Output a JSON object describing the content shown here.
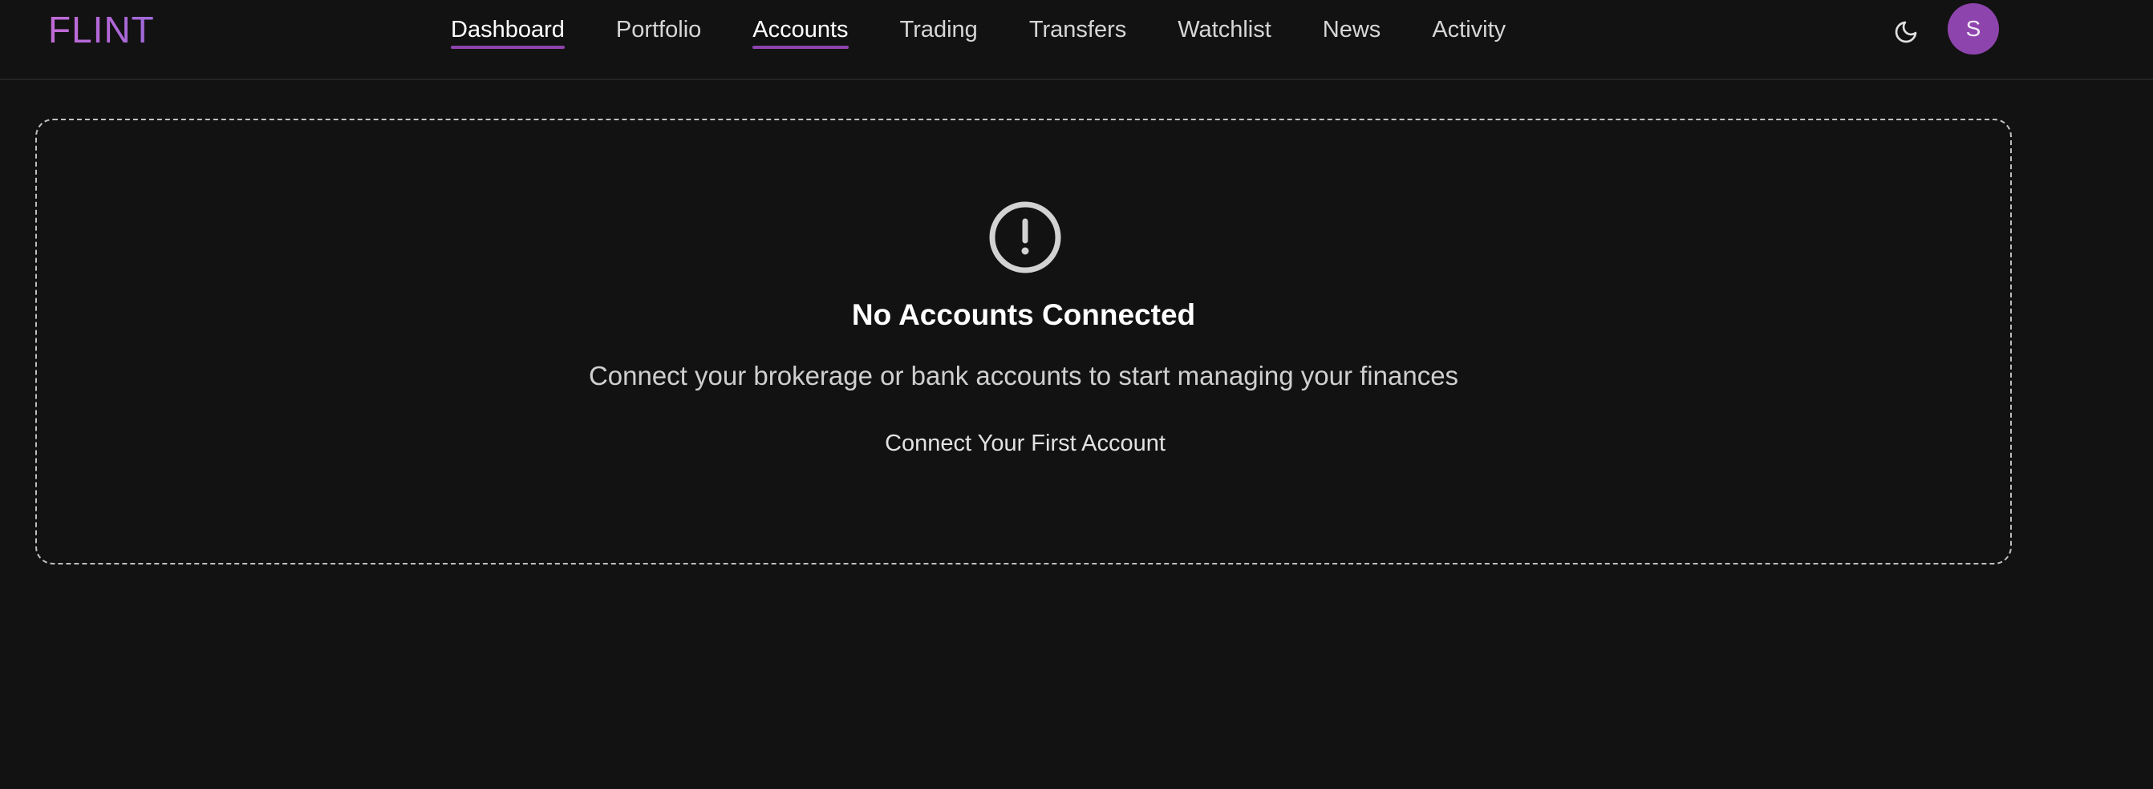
{
  "app": {
    "logo": "FLINT"
  },
  "nav": {
    "items": [
      {
        "label": "Dashboard",
        "active": true
      },
      {
        "label": "Portfolio",
        "active": false
      },
      {
        "label": "Accounts",
        "active": true
      },
      {
        "label": "Trading",
        "active": false
      },
      {
        "label": "Transfers",
        "active": false
      },
      {
        "label": "Watchlist",
        "active": false
      },
      {
        "label": "News",
        "active": false
      },
      {
        "label": "Activity",
        "active": false
      }
    ]
  },
  "header": {
    "theme_icon": "moon-icon",
    "avatar_initial": "S"
  },
  "empty_state": {
    "icon": "alert-circle-icon",
    "title": "No Accounts Connected",
    "description": "Connect your brokerage or bank accounts to start managing your finances",
    "cta_label": "Connect Your First Account"
  },
  "colors": {
    "background": "#121212",
    "accent": "#8e44ad",
    "logo_gradient_start": "#c06bd6",
    "logo_gradient_end": "#9d6ad9"
  }
}
